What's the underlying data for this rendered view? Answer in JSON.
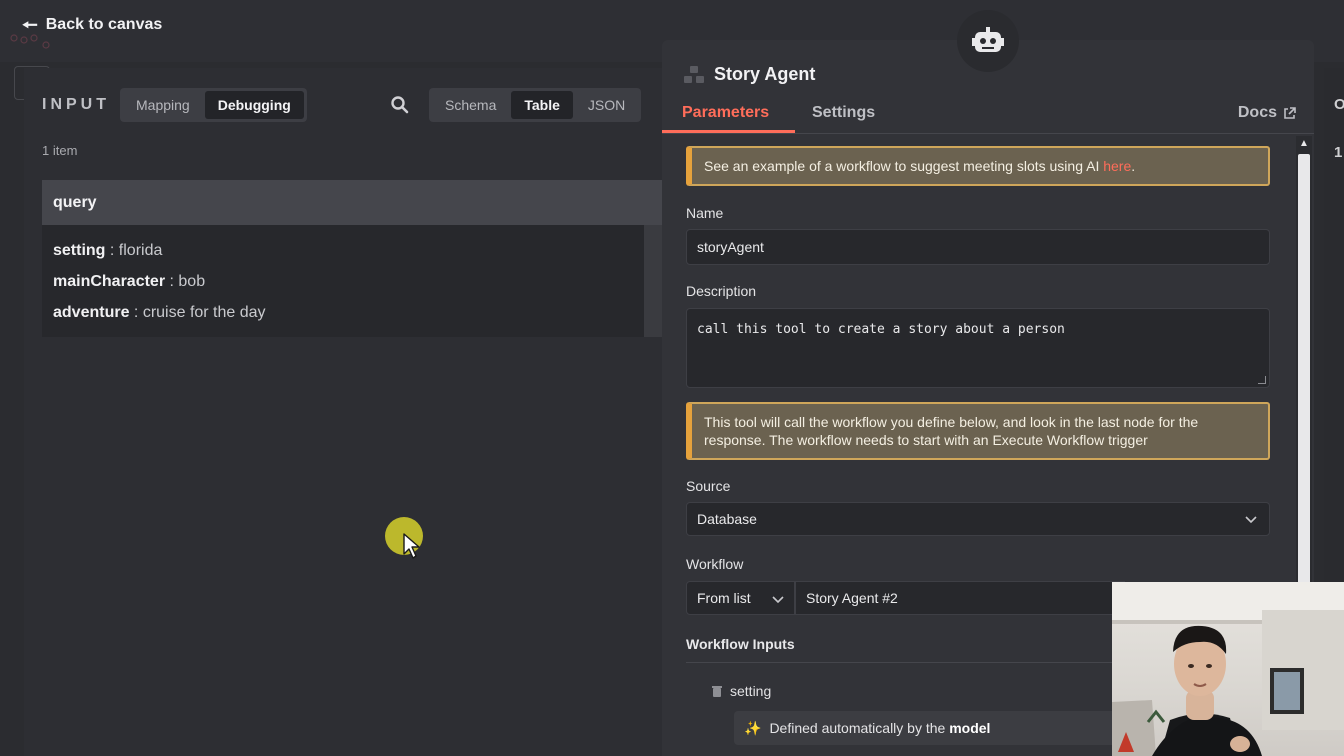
{
  "header": {
    "back_label": "Back to canvas"
  },
  "input_panel": {
    "title": "INPUT",
    "mode_tabs": [
      {
        "label": "Mapping",
        "active": false
      },
      {
        "label": "Debugging",
        "active": true
      }
    ],
    "view_tabs": [
      {
        "label": "Schema",
        "active": false
      },
      {
        "label": "Table",
        "active": true
      },
      {
        "label": "JSON",
        "active": false
      }
    ],
    "item_count": "1 item",
    "query": {
      "header": "query",
      "fields": [
        {
          "key": "setting",
          "sep": " : ",
          "value": "florida"
        },
        {
          "key": "mainCharacter",
          "sep": " : ",
          "value": "bob"
        },
        {
          "key": "adventure",
          "sep": " : ",
          "value": "cruise for the day"
        }
      ]
    }
  },
  "node": {
    "title": "Story Agent",
    "tabs": [
      {
        "label": "Parameters",
        "active": true
      },
      {
        "label": "Settings",
        "active": false
      }
    ],
    "docs_label": "Docs",
    "notice_example": {
      "text": "See an example of a workflow to suggest meeting slots using AI ",
      "link": "here",
      "end": "."
    },
    "name_label": "Name",
    "name_value": "storyAgent",
    "description_label": "Description",
    "description_value": "call this tool to create a story about a person",
    "notice_tool": "This tool will call the workflow you define below, and look in the last node for the response. The workflow needs to start with an Execute Workflow trigger",
    "source_label": "Source",
    "source_value": "Database",
    "workflow_label": "Workflow",
    "workflow_mode": "From list",
    "workflow_value": "Story Agent #2",
    "workflow_inputs_label": "Workflow Inputs",
    "input_name": "setting",
    "defined_text": "Defined automatically by the ",
    "defined_bold": "model"
  },
  "right_edge": {
    "letter": "O",
    "digit": "1"
  },
  "colors": {
    "accent": "#ff6d5a",
    "notice_border": "#e6a23c",
    "panel": "#323338",
    "field_bg": "#27282c"
  },
  "icons": [
    "arrow-left-icon",
    "search-icon",
    "robot-icon",
    "node-icon",
    "external-link-icon",
    "chevron-down-icon",
    "trash-icon",
    "sparkle-icon",
    "mouse-cursor-icon"
  ]
}
